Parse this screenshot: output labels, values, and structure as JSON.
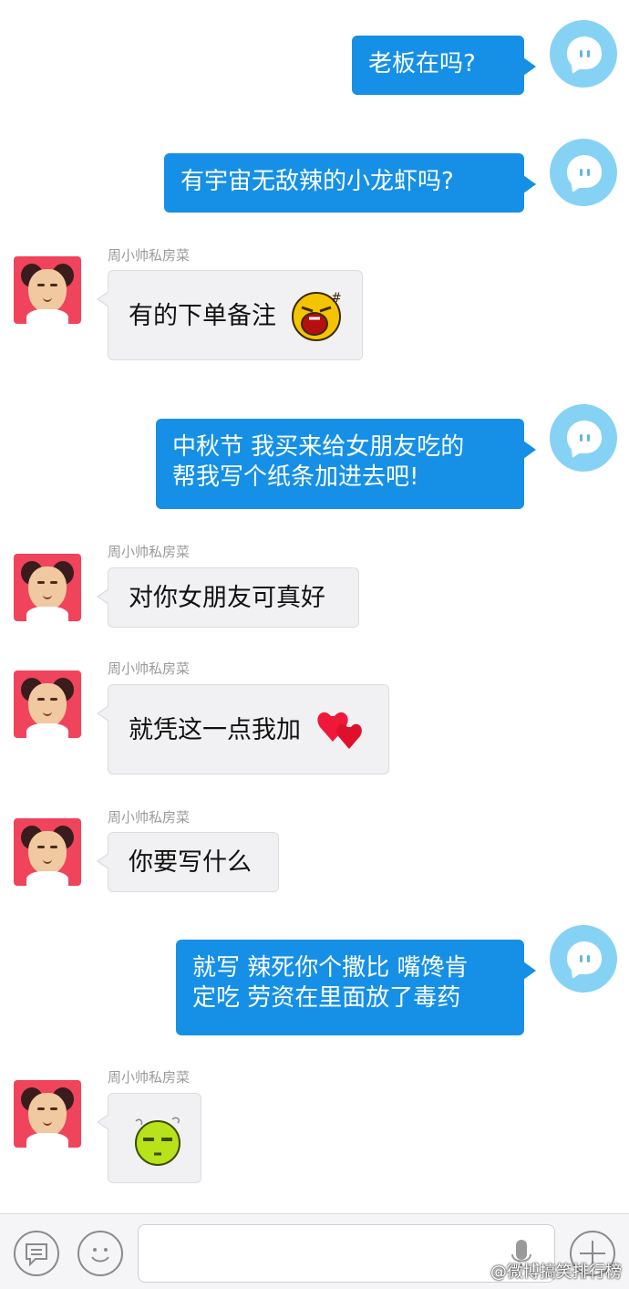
{
  "messages": [
    {
      "side": "out",
      "text": "老板在吗?"
    },
    {
      "side": "out",
      "text": "有宇宙无敌辣的小龙虾吗?"
    },
    {
      "side": "in",
      "sender": "周小帅私房菜",
      "text": "有的下单备注",
      "emoji": "angry-laughing-emoji"
    },
    {
      "side": "out",
      "text": "中秋节 我买来给女朋友吃的\n帮我写个纸条加进去吧!"
    },
    {
      "side": "in",
      "sender": "周小帅私房菜",
      "text": "对你女朋友可真好"
    },
    {
      "side": "in",
      "sender": "周小帅私房菜",
      "text": "就凭这一点我加",
      "emoji": "red-hearts-emoji"
    },
    {
      "side": "in",
      "sender": "周小帅私房菜",
      "text": "你要写什么"
    },
    {
      "side": "out",
      "text": "就写 辣死你个撒比 嘴馋肯\n定吃 劳资在里面放了毒药"
    },
    {
      "side": "in",
      "sender": "周小帅私房菜",
      "text": "",
      "emoji": "green-smirk-emoji"
    }
  ],
  "input_bar": {
    "icons": [
      "chat-menu-icon",
      "smiley-icon",
      "microphone-icon",
      "plus-icon"
    ],
    "value": ""
  },
  "watermark": "@微博搞笑排行榜",
  "colors": {
    "outgoing": "#1590e6",
    "incoming": "#f1f1f3",
    "shop_avatar": "#f0445c",
    "self_avatar": "#86d2f5"
  }
}
